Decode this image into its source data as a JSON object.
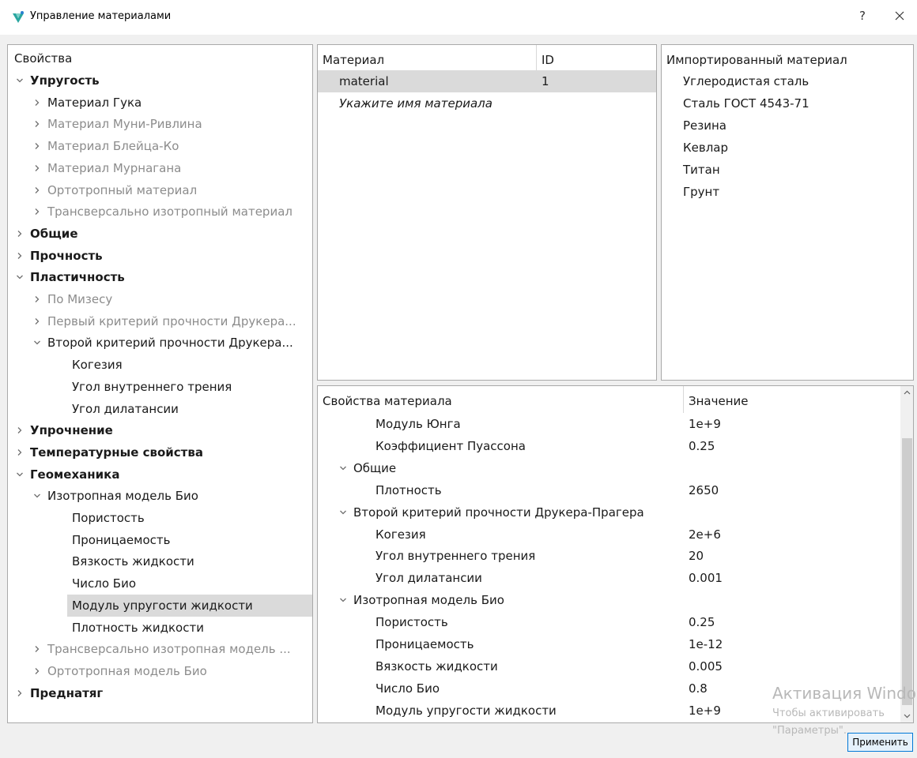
{
  "window": {
    "title": "Управление материалами",
    "help_label": "?"
  },
  "properties_tree": {
    "header": "Свойства",
    "items": [
      {
        "label": "Упругость",
        "level": 0,
        "arrow": "down",
        "style": "bold"
      },
      {
        "label": "Материал Гука",
        "level": 1,
        "arrow": "right",
        "style": "normal"
      },
      {
        "label": "Материал Муни-Ривлина",
        "level": 1,
        "arrow": "right",
        "style": "gray"
      },
      {
        "label": "Материал Блейца-Ко",
        "level": 1,
        "arrow": "right",
        "style": "gray"
      },
      {
        "label": "Материал Мурнагана",
        "level": 1,
        "arrow": "right",
        "style": "gray"
      },
      {
        "label": "Ортотропный материал",
        "level": 1,
        "arrow": "right",
        "style": "gray"
      },
      {
        "label": "Трансверсально изотропный материал",
        "level": 1,
        "arrow": "right",
        "style": "gray"
      },
      {
        "label": "Общие",
        "level": 0,
        "arrow": "right",
        "style": "bold"
      },
      {
        "label": "Прочность",
        "level": 0,
        "arrow": "right",
        "style": "bold"
      },
      {
        "label": "Пластичность",
        "level": 0,
        "arrow": "down",
        "style": "bold"
      },
      {
        "label": "По Мизесу",
        "level": 1,
        "arrow": "right",
        "style": "gray"
      },
      {
        "label": "Первый критерий прочности Друкера...",
        "level": 1,
        "arrow": "right",
        "style": "gray"
      },
      {
        "label": "Второй критерий прочности Друкера...",
        "level": 1,
        "arrow": "down",
        "style": "normal"
      },
      {
        "label": "Когезия",
        "level": 2,
        "arrow": "none",
        "style": "normal"
      },
      {
        "label": "Угол внутреннего трения",
        "level": 2,
        "arrow": "none",
        "style": "normal"
      },
      {
        "label": "Угол дилатансии",
        "level": 2,
        "arrow": "none",
        "style": "normal"
      },
      {
        "label": "Упрочнение",
        "level": 0,
        "arrow": "right",
        "style": "bold"
      },
      {
        "label": "Температурные свойства",
        "level": 0,
        "arrow": "right",
        "style": "bold"
      },
      {
        "label": "Геомеханика",
        "level": 0,
        "arrow": "down",
        "style": "bold"
      },
      {
        "label": "Изотропная модель Био",
        "level": 1,
        "arrow": "down",
        "style": "normal"
      },
      {
        "label": "Пористость",
        "level": 2,
        "arrow": "none",
        "style": "normal"
      },
      {
        "label": "Проницаемость",
        "level": 2,
        "arrow": "none",
        "style": "normal"
      },
      {
        "label": "Вязкость жидкости",
        "level": 2,
        "arrow": "none",
        "style": "normal"
      },
      {
        "label": "Число Био",
        "level": 2,
        "arrow": "none",
        "style": "normal"
      },
      {
        "label": "Модуль упругости жидкости",
        "level": 2,
        "arrow": "none",
        "style": "selected"
      },
      {
        "label": "Плотность жидкости",
        "level": 2,
        "arrow": "none",
        "style": "normal"
      },
      {
        "label": "Трансверсально изотропная модель ...",
        "level": 1,
        "arrow": "right",
        "style": "gray"
      },
      {
        "label": "Ортотропная модель Био",
        "level": 1,
        "arrow": "right",
        "style": "gray"
      },
      {
        "label": "Преднатяг",
        "level": 0,
        "arrow": "right",
        "style": "bold"
      }
    ]
  },
  "materials_table": {
    "headers": {
      "material": "Материал",
      "id": "ID"
    },
    "rows": [
      {
        "material": "material",
        "id": "1"
      }
    ],
    "placeholder": "Укажите имя материала"
  },
  "imported_materials": {
    "header": "Импортированный материал",
    "items": [
      "Углеродистая сталь",
      "Сталь ГОСТ 4543-71",
      "Резина",
      "Кевлар",
      "Титан",
      "Грунт"
    ]
  },
  "material_properties": {
    "headers": {
      "property": "Свойства материала",
      "value": "Значение"
    },
    "rows": [
      {
        "label": "Модуль Юнга",
        "value": "1e+9",
        "level": 1,
        "arrow": "none"
      },
      {
        "label": "Коэффициент Пуассона",
        "value": "0.25",
        "level": 1,
        "arrow": "none"
      },
      {
        "label": "Общие",
        "value": "",
        "level": 0,
        "arrow": "down"
      },
      {
        "label": "Плотность",
        "value": "2650",
        "level": 1,
        "arrow": "none"
      },
      {
        "label": "Второй критерий прочности Друкера-Прагера",
        "value": "",
        "level": 0,
        "arrow": "down"
      },
      {
        "label": "Когезия",
        "value": "2e+6",
        "level": 1,
        "arrow": "none"
      },
      {
        "label": "Угол внутреннего трения",
        "value": "20",
        "level": 1,
        "arrow": "none"
      },
      {
        "label": "Угол дилатансии",
        "value": "0.001",
        "level": 1,
        "arrow": "none"
      },
      {
        "label": "Изотропная модель Био",
        "value": "",
        "level": 0,
        "arrow": "down"
      },
      {
        "label": "Пористость",
        "value": "0.25",
        "level": 1,
        "arrow": "none"
      },
      {
        "label": "Проницаемость",
        "value": "1e-12",
        "level": 1,
        "arrow": "none"
      },
      {
        "label": "Вязкость жидкости",
        "value": "0.005",
        "level": 1,
        "arrow": "none"
      },
      {
        "label": "Число Био",
        "value": "0.8",
        "level": 1,
        "arrow": "none"
      },
      {
        "label": "Модуль упругости жидкости",
        "value": "1e+9",
        "level": 1,
        "arrow": "none"
      }
    ]
  },
  "watermark": {
    "line1": "Активация Windo",
    "line2": "Чтобы активировать",
    "line3": "\"Параметры\"."
  },
  "apply_button": "Применить"
}
